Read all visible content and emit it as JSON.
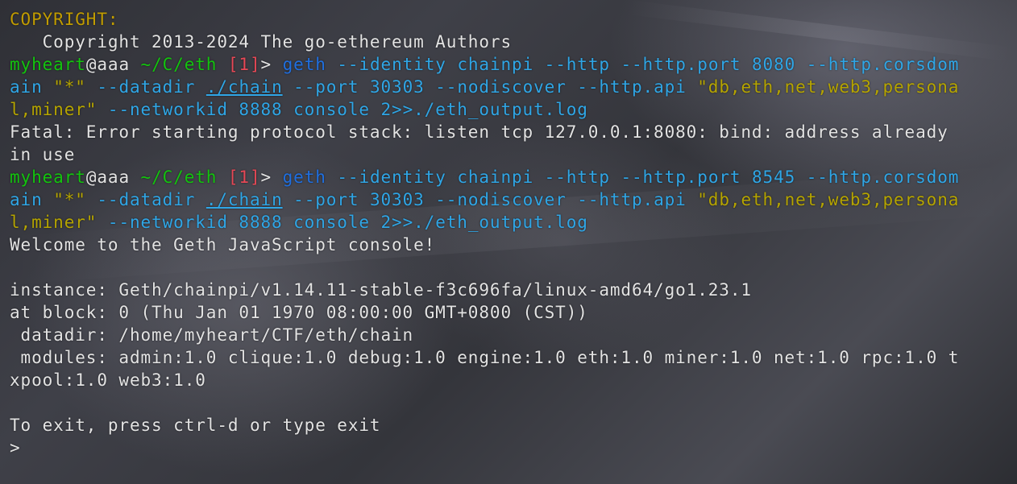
{
  "terminal": {
    "lines": [
      [
        {
          "t": "COPYRIGHT:",
          "c": "yellow"
        }
      ],
      [
        {
          "t": "   Copyright 2013-2024 The go-ethereum Authors",
          "c": "white"
        }
      ],
      [
        {
          "t": "myheart",
          "c": "green"
        },
        {
          "t": "@aaa ",
          "c": "white"
        },
        {
          "t": "~/C/eth ",
          "c": "green"
        },
        {
          "t": "[1]",
          "c": "red"
        },
        {
          "t": "> ",
          "c": "white"
        },
        {
          "t": "geth",
          "c": "blue"
        },
        {
          "t": " --identity chainpi --http --http.port 8080 --http.corsdom",
          "c": "cyan"
        }
      ],
      [
        {
          "t": "ain ",
          "c": "cyan"
        },
        {
          "t": "\"*\"",
          "c": "olive"
        },
        {
          "t": " --datadir ",
          "c": "cyan"
        },
        {
          "t": "./chain",
          "c": "cyan",
          "u": true
        },
        {
          "t": " --port 30303 --nodiscover --http.api ",
          "c": "cyan"
        },
        {
          "t": "\"db,eth,net,web3,persona",
          "c": "olive"
        }
      ],
      [
        {
          "t": "l,miner\"",
          "c": "olive"
        },
        {
          "t": " --networkid 8888 console 2>>./eth_output.log",
          "c": "cyan"
        }
      ],
      [
        {
          "t": "Fatal: Error starting protocol stack: listen tcp 127.0.0.1:8080: bind: address already",
          "c": "white"
        }
      ],
      [
        {
          "t": "in use",
          "c": "white"
        }
      ],
      [
        {
          "t": "myheart",
          "c": "green"
        },
        {
          "t": "@aaa ",
          "c": "white"
        },
        {
          "t": "~/C/eth ",
          "c": "green"
        },
        {
          "t": "[1]",
          "c": "red"
        },
        {
          "t": "> ",
          "c": "white"
        },
        {
          "t": "geth",
          "c": "blue"
        },
        {
          "t": " --identity chainpi --http --http.port 8545 --http.corsdom",
          "c": "cyan"
        }
      ],
      [
        {
          "t": "ain ",
          "c": "cyan"
        },
        {
          "t": "\"*\"",
          "c": "olive"
        },
        {
          "t": " --datadir ",
          "c": "cyan"
        },
        {
          "t": "./chain",
          "c": "cyan",
          "u": true
        },
        {
          "t": " --port 30303 --nodiscover --http.api ",
          "c": "cyan"
        },
        {
          "t": "\"db,eth,net,web3,persona",
          "c": "olive"
        }
      ],
      [
        {
          "t": "l,miner\"",
          "c": "olive"
        },
        {
          "t": " --networkid 8888 console 2>>./eth_output.log",
          "c": "cyan"
        }
      ],
      [
        {
          "t": "Welcome to the Geth JavaScript console!",
          "c": "white"
        }
      ],
      [],
      [
        {
          "t": "instance: Geth/chainpi/v1.14.11-stable-f3c696fa/linux-amd64/go1.23.1",
          "c": "white"
        }
      ],
      [
        {
          "t": "at block: 0 (Thu Jan 01 1970 08:00:00 GMT+0800 (CST))",
          "c": "white"
        }
      ],
      [
        {
          "t": " datadir: /home/myheart/CTF/eth/chain",
          "c": "white"
        }
      ],
      [
        {
          "t": " modules: admin:1.0 clique:1.0 debug:1.0 engine:1.0 eth:1.0 miner:1.0 net:1.0 rpc:1.0 t",
          "c": "white"
        }
      ],
      [
        {
          "t": "xpool:1.0 web3:1.0",
          "c": "white"
        }
      ],
      [],
      [
        {
          "t": "To exit, press ctrl-d or type exit",
          "c": "white"
        }
      ],
      [
        {
          "t": "> ",
          "c": "white"
        }
      ]
    ]
  },
  "colors": {
    "yellow": "#c19c00",
    "green": "#13c40e",
    "white": "#e3e3e3",
    "cyan": "#2fa6e6",
    "blue": "#1f6fe0",
    "red": "#e74856",
    "olive": "#b5a400"
  }
}
